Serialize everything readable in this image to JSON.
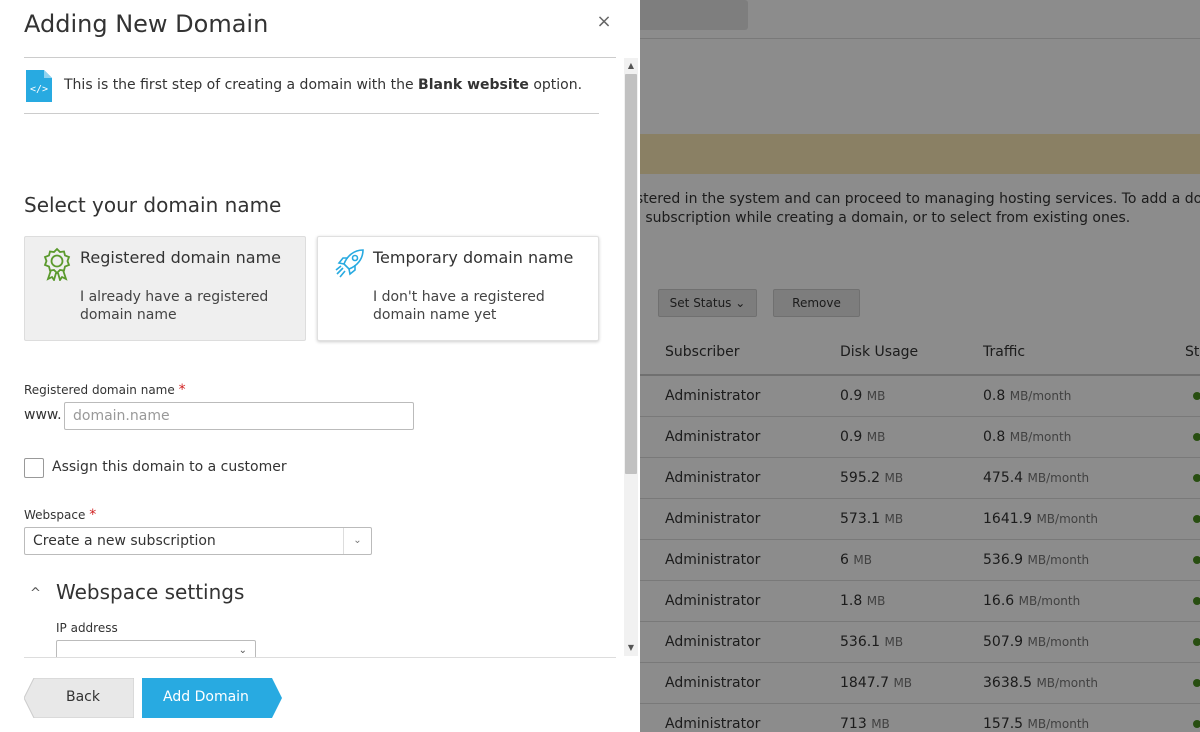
{
  "modal": {
    "title": "Adding New Domain",
    "close_label": "×",
    "info": {
      "prefix": "This is the first step of creating a domain with the ",
      "bold": "Blank website",
      "suffix": " option."
    },
    "section_title": "Select your domain name",
    "cards": [
      {
        "title": "Registered domain name",
        "description": "I already have a registered domain name",
        "selected": true,
        "icon": "award-badge-icon"
      },
      {
        "title": "Temporary domain name",
        "description": "I don't have a registered domain name yet",
        "selected": false,
        "icon": "rocket-icon"
      }
    ],
    "domain_field": {
      "label": "Registered domain name",
      "required_mark": "*",
      "prefix": "www.",
      "placeholder": "domain.name",
      "value": ""
    },
    "assign_checkbox": {
      "label": "Assign this domain to a customer",
      "checked": false
    },
    "webspace": {
      "label": "Webspace",
      "required_mark": "*",
      "selected": "Create a new subscription"
    },
    "webspace_settings": {
      "title": "Webspace settings",
      "expanded": true,
      "ip_label": "IP address",
      "ip_value": ""
    },
    "buttons": {
      "back": "Back",
      "add": "Add Domain"
    },
    "colors": {
      "primary": "#28aae1",
      "icon_green": "#5b9a2d",
      "required": "#d02020"
    }
  },
  "background": {
    "intro_line1": "istered in the system and can proceed to managing hosting services. To add a domain",
    "intro_line2": "d subscription while creating a domain, or to select from existing ones.",
    "toolbar": {
      "set_status": "Set Status ⌄",
      "remove": "Remove"
    },
    "columns": [
      "Subscriber",
      "Disk Usage",
      "Traffic",
      "St"
    ],
    "rows": [
      {
        "subscriber": "Administrator",
        "disk": "0.9",
        "disk_unit": "MB",
        "traffic": "0.8",
        "traffic_unit": "MB/month"
      },
      {
        "subscriber": "Administrator",
        "disk": "0.9",
        "disk_unit": "MB",
        "traffic": "0.8",
        "traffic_unit": "MB/month"
      },
      {
        "subscriber": "Administrator",
        "disk": "595.2",
        "disk_unit": "MB",
        "traffic": "475.4",
        "traffic_unit": "MB/month"
      },
      {
        "subscriber": "Administrator",
        "disk": "573.1",
        "disk_unit": "MB",
        "traffic": "1641.9",
        "traffic_unit": "MB/month"
      },
      {
        "subscriber": "Administrator",
        "disk": "6",
        "disk_unit": "MB",
        "traffic": "536.9",
        "traffic_unit": "MB/month"
      },
      {
        "subscriber": "Administrator",
        "disk": "1.8",
        "disk_unit": "MB",
        "traffic": "16.6",
        "traffic_unit": "MB/month"
      },
      {
        "subscriber": "Administrator",
        "disk": "536.1",
        "disk_unit": "MB",
        "traffic": "507.9",
        "traffic_unit": "MB/month"
      },
      {
        "subscriber": "Administrator",
        "disk": "1847.7",
        "disk_unit": "MB",
        "traffic": "3638.5",
        "traffic_unit": "MB/month"
      },
      {
        "subscriber": "Administrator",
        "disk": "713",
        "disk_unit": "MB",
        "traffic": "157.5",
        "traffic_unit": "MB/month"
      }
    ]
  }
}
